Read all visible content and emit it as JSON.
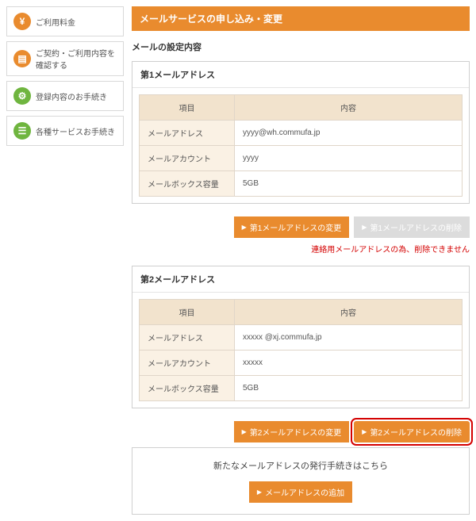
{
  "sidebar": {
    "items": [
      {
        "label": "ご利用料金",
        "icon": "yen-icon",
        "iconColor": "orange"
      },
      {
        "label": "ご契約・ご利用内容を確認する",
        "icon": "book-icon",
        "iconColor": "orange"
      },
      {
        "label": "登録内容のお手続き",
        "icon": "gear-icon",
        "iconColor": "green"
      },
      {
        "label": "各種サービスお手続き",
        "icon": "list-icon",
        "iconColor": "green"
      }
    ]
  },
  "page": {
    "title": "メールサービスの申し込み・変更",
    "section_title": "メールの設定内容"
  },
  "table_headers": {
    "item": "項目",
    "content": "内容"
  },
  "row_labels": {
    "address": "メールアドレス",
    "account": "メールアカウント",
    "capacity": "メールボックス容量"
  },
  "mail1": {
    "heading": "第1メールアドレス",
    "address": "yyyy@wh.commufa.jp",
    "account": "yyyy",
    "capacity": "5GB",
    "change_btn": "第1メールアドレスの変更",
    "delete_btn": "第1メールアドレスの削除",
    "note": "連絡用メールアドレスの為、削除できません"
  },
  "mail2": {
    "heading": "第2メールアドレス",
    "address": "xxxxx @xj.commufa.jp",
    "account": "xxxxx",
    "capacity": "5GB",
    "change_btn": "第2メールアドレスの変更",
    "delete_btn": "第2メールアドレスの削除"
  },
  "new_mail": {
    "lead": "新たなメールアドレスの発行手続きはこちら",
    "add_btn": "メールアドレスの追加"
  }
}
